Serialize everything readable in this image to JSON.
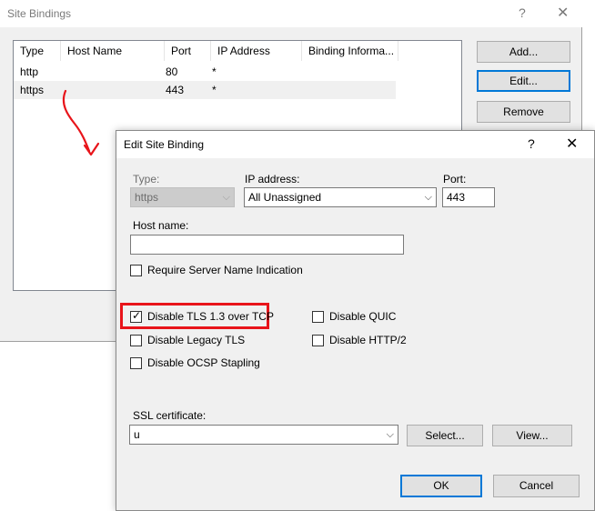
{
  "site_bindings": {
    "title": "Site Bindings",
    "help_glyph": "?",
    "close_glyph": "✕",
    "columns": [
      "Type",
      "Host Name",
      "Port",
      "IP Address",
      "Binding Informa..."
    ],
    "rows": [
      {
        "type": "http",
        "host": "",
        "port": "80",
        "ip": "*",
        "info": ""
      },
      {
        "type": "https",
        "host": "",
        "port": "443",
        "ip": "*",
        "info": ""
      }
    ],
    "buttons": {
      "add": "Add...",
      "edit": "Edit...",
      "remove": "Remove"
    }
  },
  "edit_dialog": {
    "title": "Edit Site Binding",
    "help_glyph": "?",
    "close_glyph": "✕",
    "type_label": "Type:",
    "type_value": "https",
    "ip_label": "IP address:",
    "ip_value": "All Unassigned",
    "port_label": "Port:",
    "port_value": "443",
    "host_label": "Host name:",
    "host_value": "",
    "sni_label": "Require Server Name Indication",
    "sni_checked": false,
    "options": {
      "disable_tls13": {
        "label": "Disable TLS 1.3 over TCP",
        "checked": true
      },
      "disable_legacy_tls": {
        "label": "Disable Legacy TLS",
        "checked": false
      },
      "disable_ocsp": {
        "label": "Disable OCSP Stapling",
        "checked": false
      },
      "disable_quic": {
        "label": "Disable QUIC",
        "checked": false
      },
      "disable_http2": {
        "label": "Disable HTTP/2",
        "checked": false
      }
    },
    "ssl_label": "SSL certificate:",
    "ssl_value": "u",
    "buttons": {
      "select": "Select...",
      "view": "View...",
      "ok": "OK",
      "cancel": "Cancel"
    }
  },
  "colors": {
    "highlight": "#e8141a",
    "arrow": "#e8141a",
    "accent": "#0078d7"
  },
  "icons": {
    "dropdown": "chevron-down-icon",
    "check": "check-icon"
  }
}
